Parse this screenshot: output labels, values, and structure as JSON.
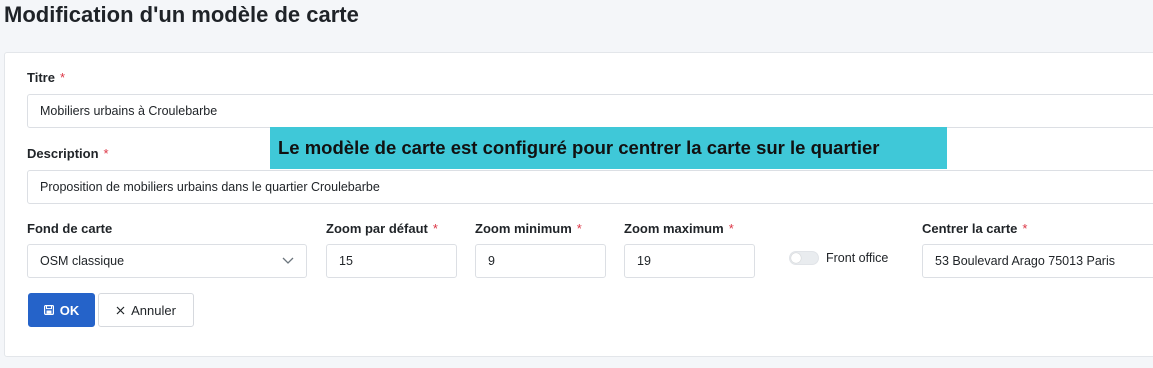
{
  "page": {
    "title": "Modification d'un modèle de carte"
  },
  "form": {
    "required_mark": "*",
    "titre": {
      "label": "Titre",
      "value": "Mobiliers urbains à Croulebarbe"
    },
    "description": {
      "label": "Description",
      "value": "Proposition de mobiliers urbains dans le quartier Croulebarbe"
    },
    "fond_de_carte": {
      "label": "Fond de carte",
      "value": "OSM classique"
    },
    "zoom_defaut": {
      "label": "Zoom par défaut",
      "value": "15"
    },
    "zoom_minimum": {
      "label": "Zoom minimum",
      "value": "9"
    },
    "zoom_maximum": {
      "label": "Zoom maximum",
      "value": "19"
    },
    "front_office": {
      "label": "Front office",
      "checked": false
    },
    "centrer_carte": {
      "label": "Centrer la carte",
      "value": "53 Boulevard Arago 75013 Paris"
    }
  },
  "actions": {
    "ok_label": "OK",
    "cancel_label": "Annuler"
  },
  "annotation": {
    "text": "Le modèle de carte est configuré pour centrer la carte sur le quartier",
    "color": "#3fc8d8"
  },
  "colors": {
    "primary": "#2563c9",
    "required": "#dc3545"
  },
  "icons": {
    "ok": "save-icon",
    "cancel": "close-icon",
    "select": "chevron-down-icon"
  }
}
